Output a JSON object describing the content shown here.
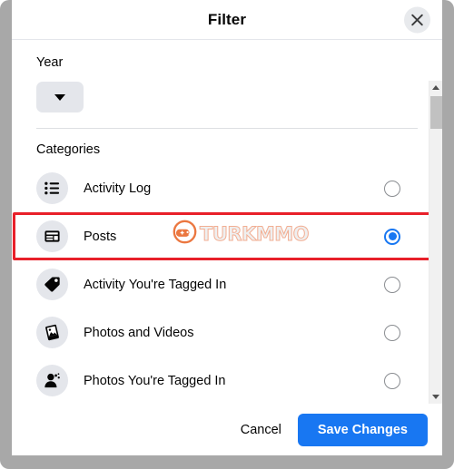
{
  "dialog": {
    "title": "Filter",
    "close_icon": "close-icon"
  },
  "year": {
    "label": "Year",
    "value": "",
    "chevron_icon": "chevron-down-icon"
  },
  "categories": {
    "label": "Categories",
    "items": [
      {
        "label": "Activity Log",
        "icon": "list-icon",
        "selected": false
      },
      {
        "label": "Posts",
        "icon": "article-icon",
        "selected": true
      },
      {
        "label": "Activity You're Tagged In",
        "icon": "tag-icon",
        "selected": false
      },
      {
        "label": "Photos and Videos",
        "icon": "photo-icon",
        "selected": false
      },
      {
        "label": "Photos You're Tagged In",
        "icon": "person-tag-icon",
        "selected": false
      }
    ]
  },
  "footer": {
    "cancel_label": "Cancel",
    "save_label": "Save Changes"
  },
  "watermark": {
    "text": "TURKMMO",
    "logo_icon": "turkmmo-logo-icon"
  },
  "scrollbar": {
    "up_icon": "scroll-up-arrow-icon",
    "down_icon": "scroll-down-arrow-icon"
  },
  "colors": {
    "accent": "#1877f2",
    "highlight": "#e8202a",
    "surface": "#ffffff",
    "icon_bg": "#e4e6eb",
    "frame": "#a8a8a8"
  }
}
